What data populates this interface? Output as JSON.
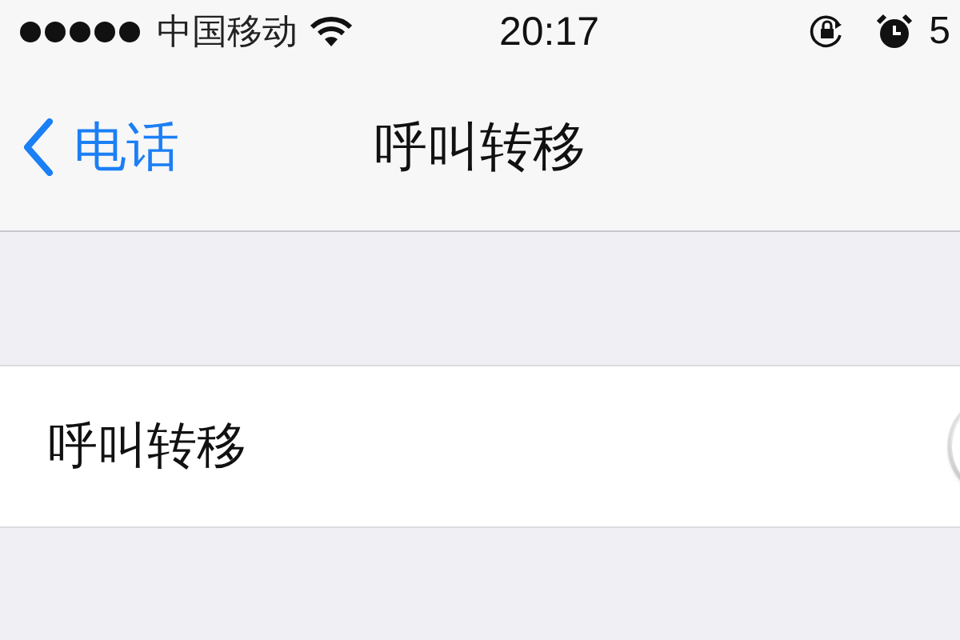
{
  "status_bar": {
    "carrier": "中国移动",
    "time": "20:17",
    "battery_percent": "5"
  },
  "nav_bar": {
    "back_label": "电话",
    "title": "呼叫转移"
  },
  "settings": [
    {
      "label": "呼叫转移",
      "kind": "switch",
      "on": false
    }
  ]
}
